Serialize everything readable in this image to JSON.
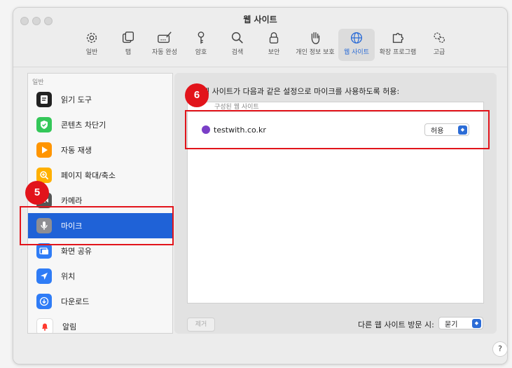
{
  "window": {
    "title": "웹 사이트"
  },
  "toolbar": {
    "items": [
      {
        "label": "일반",
        "icon": "gear-icon"
      },
      {
        "label": "탭",
        "icon": "tabs-icon"
      },
      {
        "label": "자동 완성",
        "icon": "autofill-icon"
      },
      {
        "label": "암호",
        "icon": "key-icon"
      },
      {
        "label": "검색",
        "icon": "search-icon"
      },
      {
        "label": "보안",
        "icon": "lock-icon"
      },
      {
        "label": "개인 정보 보호",
        "icon": "hand-icon"
      },
      {
        "label": "웹 사이트",
        "icon": "globe-icon",
        "active": true
      },
      {
        "label": "확장 프로그램",
        "icon": "puzzle-icon"
      },
      {
        "label": "고급",
        "icon": "advanced-gears-icon"
      }
    ]
  },
  "sidebar": {
    "section_label": "일반",
    "items": [
      {
        "label": "읽기 도구",
        "icon": "reader-icon",
        "color": "#222222"
      },
      {
        "label": "콘텐츠 차단기",
        "icon": "content-blocker-icon",
        "color": "#34c759"
      },
      {
        "label": "자동 재생",
        "icon": "play-icon",
        "color": "#ff9500"
      },
      {
        "label": "페이지 확대/축소",
        "icon": "zoom-icon",
        "color": "#ffb000"
      },
      {
        "label": "카메라",
        "icon": "camera-icon",
        "color": "#555555"
      },
      {
        "label": "마이크",
        "icon": "microphone-icon",
        "color": "#8e8e93",
        "selected": true
      },
      {
        "label": "화면 공유",
        "icon": "screen-share-icon",
        "color": "#2f7cf6"
      },
      {
        "label": "위치",
        "icon": "location-icon",
        "color": "#2f7cf6"
      },
      {
        "label": "다운로드",
        "icon": "download-icon",
        "color": "#2f7cf6"
      },
      {
        "label": "알림",
        "icon": "bell-icon",
        "color": "#ff3b30"
      }
    ]
  },
  "main": {
    "panel_title": "웹 사이트가 다음과 같은 설정으로 마이크를 사용하도록 허용:",
    "list_header": "구성된 웹 사이트",
    "sites": [
      {
        "domain": "testwith.co.kr",
        "setting": "허용"
      }
    ],
    "remove_label": "제거",
    "other_sites_label": "다른 웹 사이트 방문 시:",
    "other_sites_value": "묻기",
    "help_label": "?"
  },
  "annotations": {
    "badge_sidebar": "5",
    "badge_site": "6",
    "highlight_color": "#e2141b"
  },
  "colors": {
    "accent": "#1f62d7",
    "selected_text": "#ffffff"
  }
}
